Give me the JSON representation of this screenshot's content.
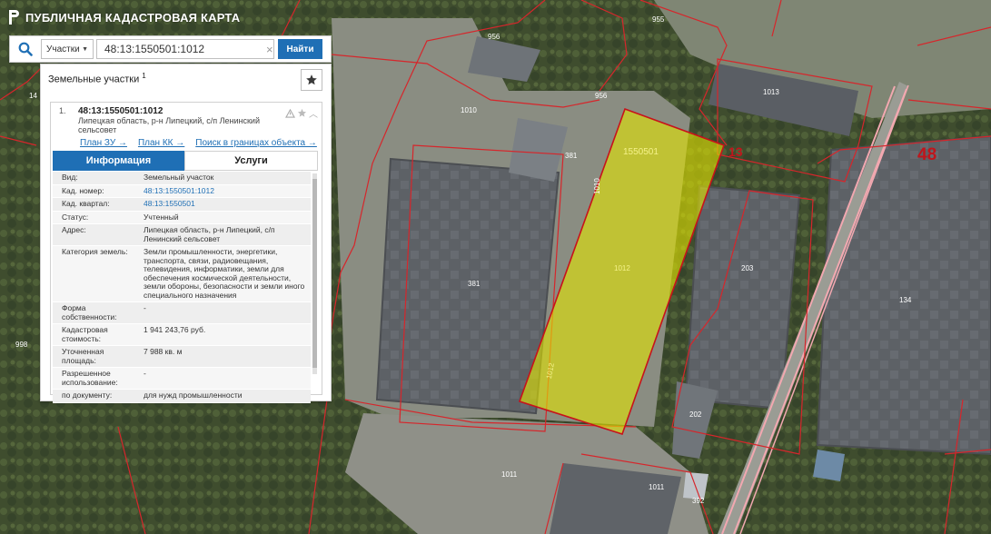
{
  "app": {
    "title": "ПУБЛИЧНАЯ КАДАСТРОВАЯ КАРТА"
  },
  "search": {
    "type_label": "Участки",
    "query": "48:13:1550501:1012",
    "button_label": "Найти"
  },
  "panel": {
    "title": "Земельные участки",
    "count": "1",
    "result": {
      "number": "1.",
      "cad_number": "48:13:1550501:1012",
      "address": "Липецкая область, р-н Липецкий, с/п Ленинский сельсовет",
      "links": [
        "План ЗУ →",
        "План КК →",
        "Поиск в границах объекта →"
      ],
      "tabs": [
        "Информация",
        "Услуги"
      ],
      "info": [
        {
          "key": "Вид:",
          "value": "Земельный участок"
        },
        {
          "key": "Кад. номер:",
          "value": "48:13:1550501:1012"
        },
        {
          "key": "Кад. квартал:",
          "value": "48:13:1550501"
        },
        {
          "key": "Статус:",
          "value": "Учтенный"
        },
        {
          "key": "Адрес:",
          "value": "Липецкая область, р-н Липецкий, с/п Ленинский сельсовет"
        },
        {
          "key": "Категория земель:",
          "value": "Земли промышленности, энергетики, транспорта, связи, радиовещания, телевидения, информатики, земли для обеспечения космической деятельности, земли обороны, безопасности и земли иного специального назначения"
        },
        {
          "key": "Форма собственности:",
          "value": "-"
        },
        {
          "key": "Кадастровая стоимость:",
          "value": "1 941 243,76 руб."
        },
        {
          "key": "Уточненная площадь:",
          "value": "7 988 кв. м"
        },
        {
          "key": "Разрешенное использование:",
          "value": "-"
        },
        {
          "key": "по документу:",
          "value": "для нужд промышленности"
        }
      ]
    }
  },
  "map": {
    "labels": {
      "l955": "955",
      "l956a": "956",
      "l956b": "956",
      "l1013": "1013",
      "l1010a": "1010",
      "l1010b": "1010",
      "l381a": "381",
      "l381b": "381",
      "l1550501": "1550501",
      "l13": "13",
      "l48": "48",
      "l1012a": "1012",
      "l1012b": "1012",
      "l203": "203",
      "l134": "134",
      "l998": "998",
      "l14": "14",
      "l202": "202",
      "l1011a": "1011",
      "l1011b": "1011",
      "l392": "392"
    }
  },
  "colors": {
    "accent": "#1f6fb5",
    "parcel_fill": "#e4e600",
    "boundary": "#d6262b"
  }
}
